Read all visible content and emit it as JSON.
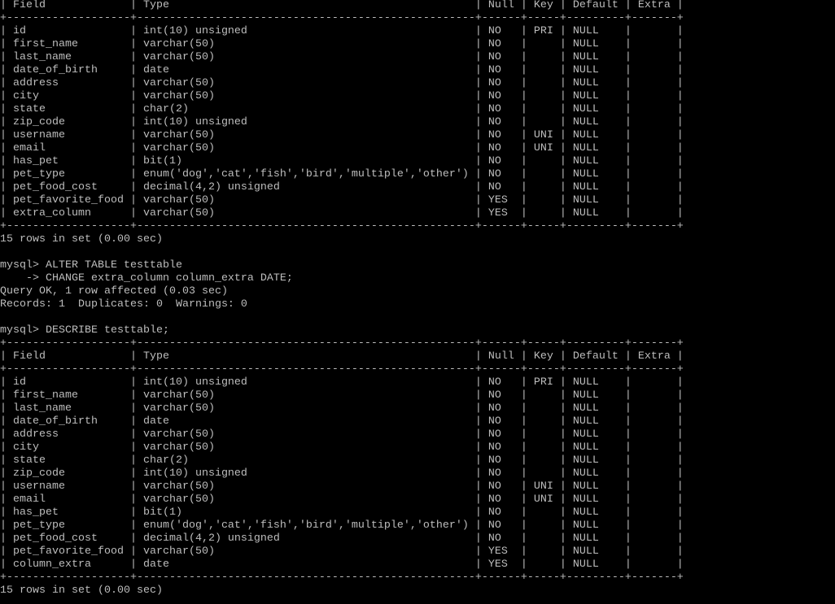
{
  "terminal": {
    "text_color": "#bdbdbd",
    "background": "#000000",
    "columns": [
      "Field",
      "Type",
      "Null",
      "Key",
      "Default",
      "Extra"
    ],
    "first_table": {
      "rows": [
        [
          "id",
          "int(10) unsigned",
          "NO",
          "PRI",
          "NULL",
          ""
        ],
        [
          "first_name",
          "varchar(50)",
          "NO",
          "",
          "NULL",
          ""
        ],
        [
          "last_name",
          "varchar(50)",
          "NO",
          "",
          "NULL",
          ""
        ],
        [
          "date_of_birth",
          "date",
          "NO",
          "",
          "NULL",
          ""
        ],
        [
          "address",
          "varchar(50)",
          "NO",
          "",
          "NULL",
          ""
        ],
        [
          "city",
          "varchar(50)",
          "NO",
          "",
          "NULL",
          ""
        ],
        [
          "state",
          "char(2)",
          "NO",
          "",
          "NULL",
          ""
        ],
        [
          "zip_code",
          "int(10) unsigned",
          "NO",
          "",
          "NULL",
          ""
        ],
        [
          "username",
          "varchar(50)",
          "NO",
          "UNI",
          "NULL",
          ""
        ],
        [
          "email",
          "varchar(50)",
          "NO",
          "UNI",
          "NULL",
          ""
        ],
        [
          "has_pet",
          "bit(1)",
          "NO",
          "",
          "NULL",
          ""
        ],
        [
          "pet_type",
          "enum('dog','cat','fish','bird','multiple','other')",
          "NO",
          "",
          "NULL",
          ""
        ],
        [
          "pet_food_cost",
          "decimal(4,2) unsigned",
          "NO",
          "",
          "NULL",
          ""
        ],
        [
          "pet_favorite_food",
          "varchar(50)",
          "YES",
          "",
          "NULL",
          ""
        ],
        [
          "extra_column",
          "varchar(50)",
          "YES",
          "",
          "NULL",
          ""
        ]
      ],
      "footer": "15 rows in set (0.00 sec)"
    },
    "commands": [
      "",
      "mysql> ALTER TABLE testtable",
      "    -> CHANGE extra_column column_extra DATE;",
      "Query OK, 1 row affected (0.03 sec)",
      "Records: 1  Duplicates: 0  Warnings: 0",
      "",
      "mysql> DESCRIBE testtable;"
    ],
    "second_table": {
      "rows": [
        [
          "id",
          "int(10) unsigned",
          "NO",
          "PRI",
          "NULL",
          ""
        ],
        [
          "first_name",
          "varchar(50)",
          "NO",
          "",
          "NULL",
          ""
        ],
        [
          "last_name",
          "varchar(50)",
          "NO",
          "",
          "NULL",
          ""
        ],
        [
          "date_of_birth",
          "date",
          "NO",
          "",
          "NULL",
          ""
        ],
        [
          "address",
          "varchar(50)",
          "NO",
          "",
          "NULL",
          ""
        ],
        [
          "city",
          "varchar(50)",
          "NO",
          "",
          "NULL",
          ""
        ],
        [
          "state",
          "char(2)",
          "NO",
          "",
          "NULL",
          ""
        ],
        [
          "zip_code",
          "int(10) unsigned",
          "NO",
          "",
          "NULL",
          ""
        ],
        [
          "username",
          "varchar(50)",
          "NO",
          "UNI",
          "NULL",
          ""
        ],
        [
          "email",
          "varchar(50)",
          "NO",
          "UNI",
          "NULL",
          ""
        ],
        [
          "has_pet",
          "bit(1)",
          "NO",
          "",
          "NULL",
          ""
        ],
        [
          "pet_type",
          "enum('dog','cat','fish','bird','multiple','other')",
          "NO",
          "",
          "NULL",
          ""
        ],
        [
          "pet_food_cost",
          "decimal(4,2) unsigned",
          "NO",
          "",
          "NULL",
          ""
        ],
        [
          "pet_favorite_food",
          "varchar(50)",
          "YES",
          "",
          "NULL",
          ""
        ],
        [
          "column_extra",
          "date",
          "YES",
          "",
          "NULL",
          ""
        ]
      ],
      "footer": "15 rows in set (0.00 sec)"
    }
  }
}
